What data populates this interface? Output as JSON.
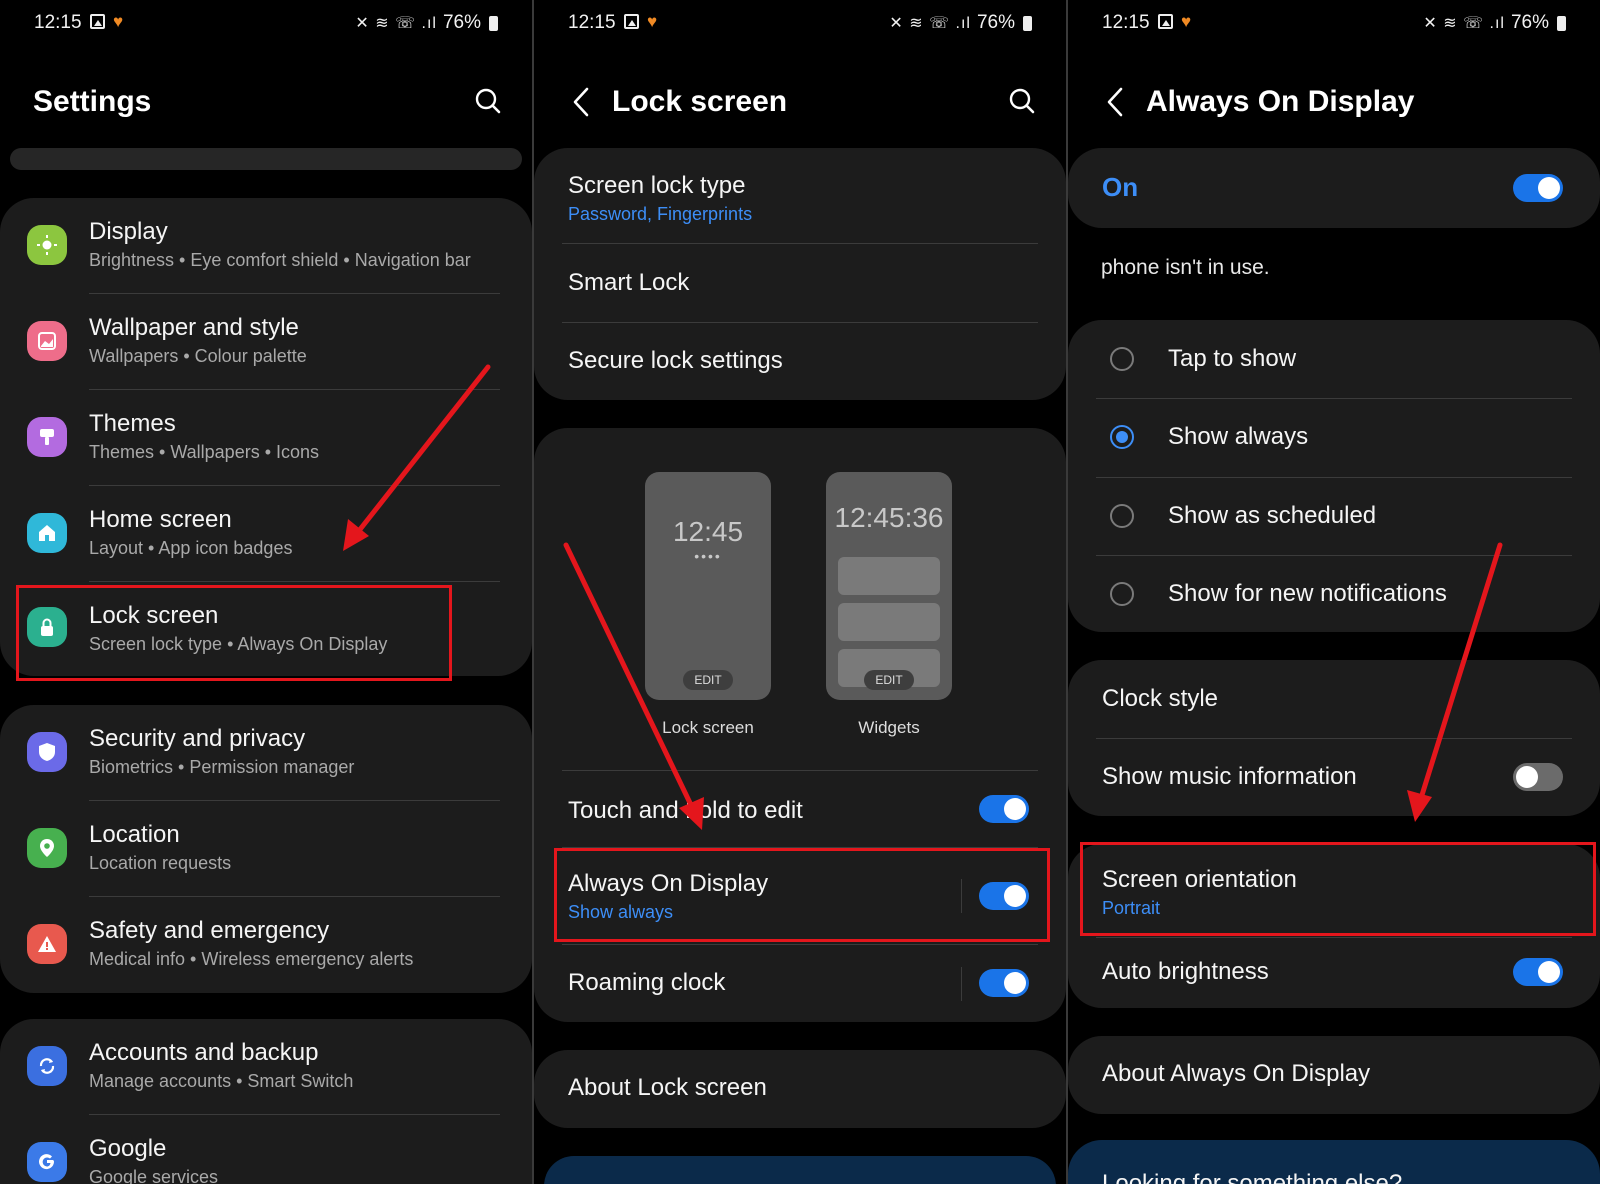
{
  "status": {
    "time": "12:15",
    "battery": "76%",
    "signal": "◢ ◢"
  },
  "panel1": {
    "title": "Settings",
    "items": [
      {
        "title": "Display",
        "subtitle": "Brightness  •  Eye comfort shield  •  Navigation bar",
        "icon": "display-icon",
        "color": "#8cc63f"
      },
      {
        "title": "Wallpaper and style",
        "subtitle": "Wallpapers  •  Colour palette",
        "icon": "wallpaper-icon",
        "color": "#ee6d8a"
      },
      {
        "title": "Themes",
        "subtitle": "Themes  •  Wallpapers  •  Icons",
        "icon": "themes-icon",
        "color": "#b36be0"
      },
      {
        "title": "Home screen",
        "subtitle": "Layout  •  App icon badges",
        "icon": "home-icon",
        "color": "#2fb8d9"
      },
      {
        "title": "Lock screen",
        "subtitle": "Screen lock type  •  Always On Display",
        "icon": "lock-icon",
        "color": "#2bb08f"
      },
      {
        "title": "Security and privacy",
        "subtitle": "Biometrics  •  Permission manager",
        "icon": "shield-icon",
        "color": "#6b6ae8"
      },
      {
        "title": "Location",
        "subtitle": "Location requests",
        "icon": "location-icon",
        "color": "#47b04f"
      },
      {
        "title": "Safety and emergency",
        "subtitle": "Medical info  •  Wireless emergency alerts",
        "icon": "alert-icon",
        "color": "#e8594e"
      },
      {
        "title": "Accounts and backup",
        "subtitle": "Manage accounts  •  Smart Switch",
        "icon": "sync-icon",
        "color": "#3b6fe0"
      },
      {
        "title": "Google",
        "subtitle": "Google services",
        "icon": "google-icon",
        "color": "#3b7ae8"
      }
    ]
  },
  "panel2": {
    "title": "Lock screen",
    "screen_lock_type": {
      "title": "Screen lock type",
      "subtitle": "Password, Fingerprints"
    },
    "smart_lock": "Smart Lock",
    "secure_lock": "Secure lock settings",
    "preview_lock": {
      "clock": "12:45",
      "dots": "••••",
      "edit": "EDIT",
      "label": "Lock screen"
    },
    "preview_widgets": {
      "clock": "12:45:36",
      "edit": "EDIT",
      "label": "Widgets"
    },
    "touch_hold": {
      "title": "Touch and hold to edit",
      "on": true
    },
    "aod": {
      "title": "Always On Display",
      "subtitle": "Show always",
      "on": true
    },
    "roaming": {
      "title": "Roaming clock",
      "on": true
    },
    "about": "About Lock screen"
  },
  "panel3": {
    "title": "Always On Display",
    "master": {
      "label": "On",
      "on": true
    },
    "description": "phone isn't in use.",
    "options": [
      {
        "label": "Tap to show",
        "checked": false
      },
      {
        "label": "Show always",
        "checked": true
      },
      {
        "label": "Show as scheduled",
        "checked": false
      },
      {
        "label": "Show for new notifications",
        "checked": false
      }
    ],
    "clock_style": "Clock style",
    "music": {
      "title": "Show music information",
      "on": false
    },
    "orientation": {
      "title": "Screen orientation",
      "subtitle": "Portrait"
    },
    "auto_brightness": {
      "title": "Auto brightness",
      "on": true
    },
    "about": "About Always On Display",
    "looking": "Looking for something else?"
  },
  "colors": {
    "accent": "#1a74e8",
    "link": "#3d8ef7",
    "highlight": "#e4161c",
    "card": "#1c1c1c"
  }
}
